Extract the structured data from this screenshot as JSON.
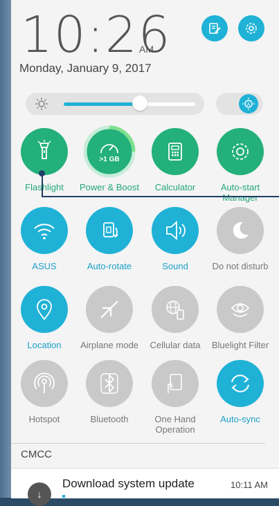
{
  "clock": {
    "time": "10:26",
    "ampm": "AM",
    "date": "Monday, January 9, 2017"
  },
  "header_buttons": [
    {
      "icon": "notes-edit-icon"
    },
    {
      "icon": "gear-icon"
    }
  ],
  "brightness": {
    "level_fraction": 0.58,
    "auto_icon": "auto-brightness-icon"
  },
  "tiles": [
    {
      "label": "Flashlight",
      "icon": "flashlight-icon",
      "state": "on",
      "color": "#23b07a"
    },
    {
      "label": "Power & Boost",
      "icon": "speedometer-icon",
      "badge": ">1 GB",
      "state": "on",
      "color": "#23b07a"
    },
    {
      "label": "Calculator",
      "icon": "calculator-icon",
      "state": "on",
      "color": "#23b07a"
    },
    {
      "label": "Auto-start Manager",
      "icon": "gear-badge-icon",
      "state": "on",
      "color": "#23b07a"
    },
    {
      "label": "ASUS",
      "icon": "wifi-icon",
      "state": "on",
      "color": "#1fb2d6"
    },
    {
      "label": "Auto-rotate",
      "icon": "rotate-icon",
      "state": "on",
      "color": "#1fb2d6"
    },
    {
      "label": "Sound",
      "icon": "speaker-icon",
      "state": "on",
      "color": "#1fb2d6"
    },
    {
      "label": "Do not disturb",
      "icon": "moon-icon",
      "state": "off",
      "color": "#c9c9c9"
    },
    {
      "label": "Location",
      "icon": "location-pin-icon",
      "state": "on",
      "color": "#1fb2d6"
    },
    {
      "label": "Airplane mode",
      "icon": "airplane-icon",
      "state": "off",
      "color": "#c9c9c9"
    },
    {
      "label": "Cellular data",
      "icon": "globe-phone-icon",
      "state": "off",
      "color": "#c9c9c9"
    },
    {
      "label": "Bluelight Filter",
      "icon": "eye-icon",
      "state": "off",
      "color": "#c9c9c9"
    },
    {
      "label": "Hotspot",
      "icon": "hotspot-icon",
      "state": "off",
      "color": "#c9c9c9"
    },
    {
      "label": "Bluetooth",
      "icon": "bluetooth-icon",
      "state": "off",
      "color": "#c9c9c9"
    },
    {
      "label": "One Hand Operation",
      "icon": "one-hand-icon",
      "state": "off",
      "color": "#c9c9c9"
    },
    {
      "label": "Auto-sync",
      "icon": "sync-icon",
      "state": "on",
      "color": "#1fb2d6"
    }
  ],
  "carrier": "CMCC",
  "notification": {
    "title": "Download system update",
    "time": "10:11 AM"
  }
}
